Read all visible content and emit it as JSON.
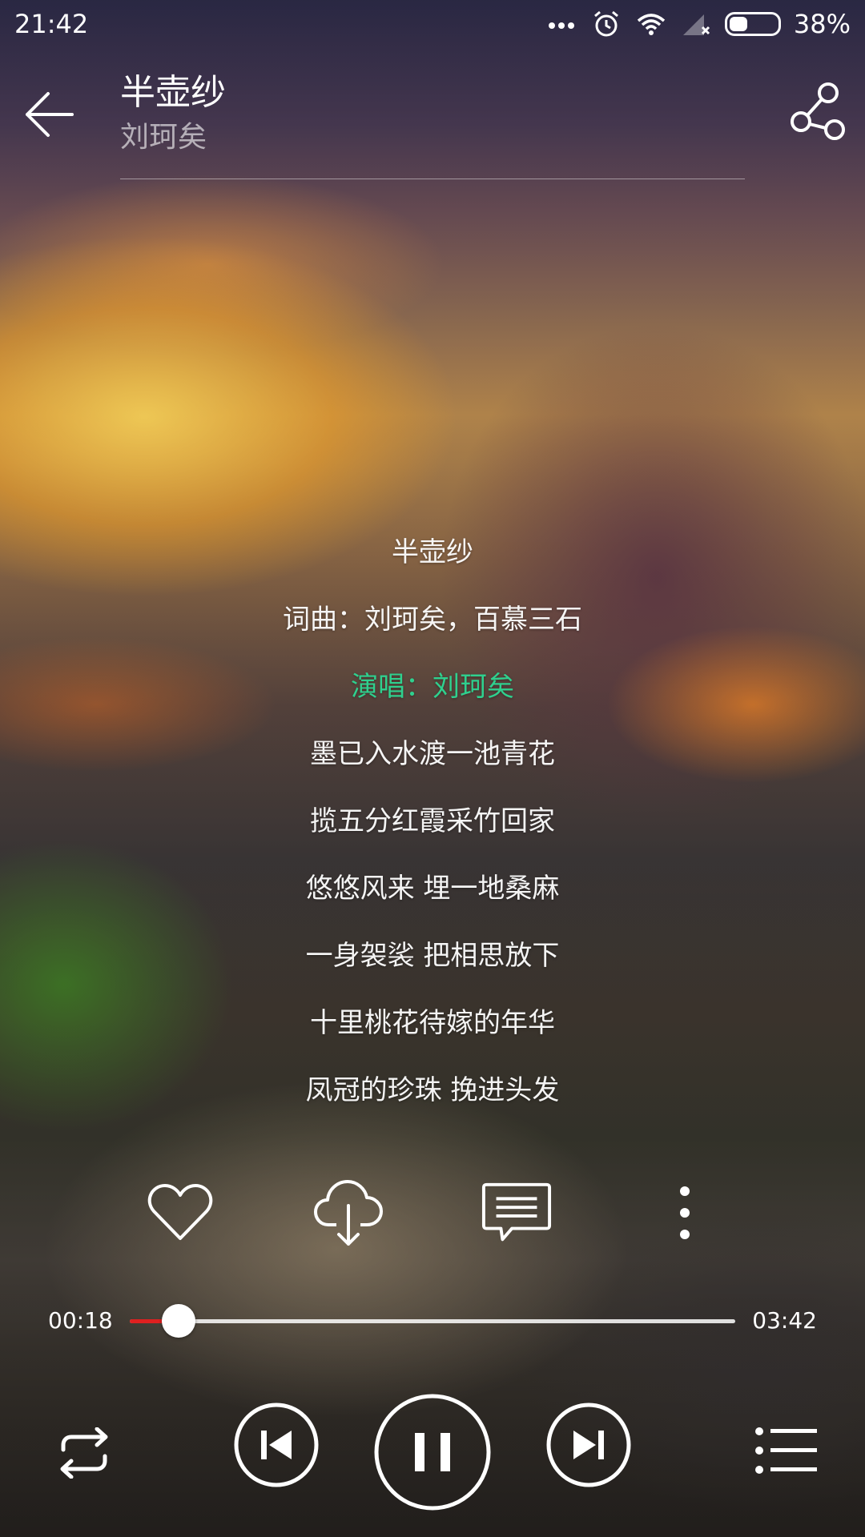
{
  "status": {
    "time": "21:42",
    "battery_text": "38%",
    "battery_level": 0.38,
    "icons": [
      "more-dots-icon",
      "alarm-icon",
      "wifi-icon",
      "no-signal-icon",
      "battery-icon"
    ]
  },
  "header": {
    "title": "半壶纱",
    "artist": "刘珂矣",
    "back_icon": "back-arrow-icon",
    "share_icon": "share-icon"
  },
  "lyrics": [
    {
      "text": "半壶纱",
      "active": false
    },
    {
      "text": "词曲：刘珂矣，百慕三石",
      "active": false
    },
    {
      "text": "演唱：刘珂矣",
      "active": true
    },
    {
      "text": "墨已入水渡一池青花",
      "active": false
    },
    {
      "text": "揽五分红霞采竹回家",
      "active": false
    },
    {
      "text": "悠悠风来 埋一地桑麻",
      "active": false
    },
    {
      "text": "一身袈裟 把相思放下",
      "active": false
    },
    {
      "text": "十里桃花待嫁的年华",
      "active": false
    },
    {
      "text": "凤冠的珍珠 挽进头发",
      "active": false
    }
  ],
  "actions": [
    "favorite-heart-icon",
    "download-cloud-icon",
    "comment-icon",
    "more-vertical-icon"
  ],
  "progress": {
    "current": "00:18",
    "total": "03:42",
    "fraction": 0.081
  },
  "controls": [
    "repeat-icon",
    "previous-icon",
    "pause-icon",
    "next-icon",
    "playlist-icon"
  ],
  "colors": {
    "accent_lyric": "#2fd08e",
    "progress_fill": "#e02020"
  }
}
